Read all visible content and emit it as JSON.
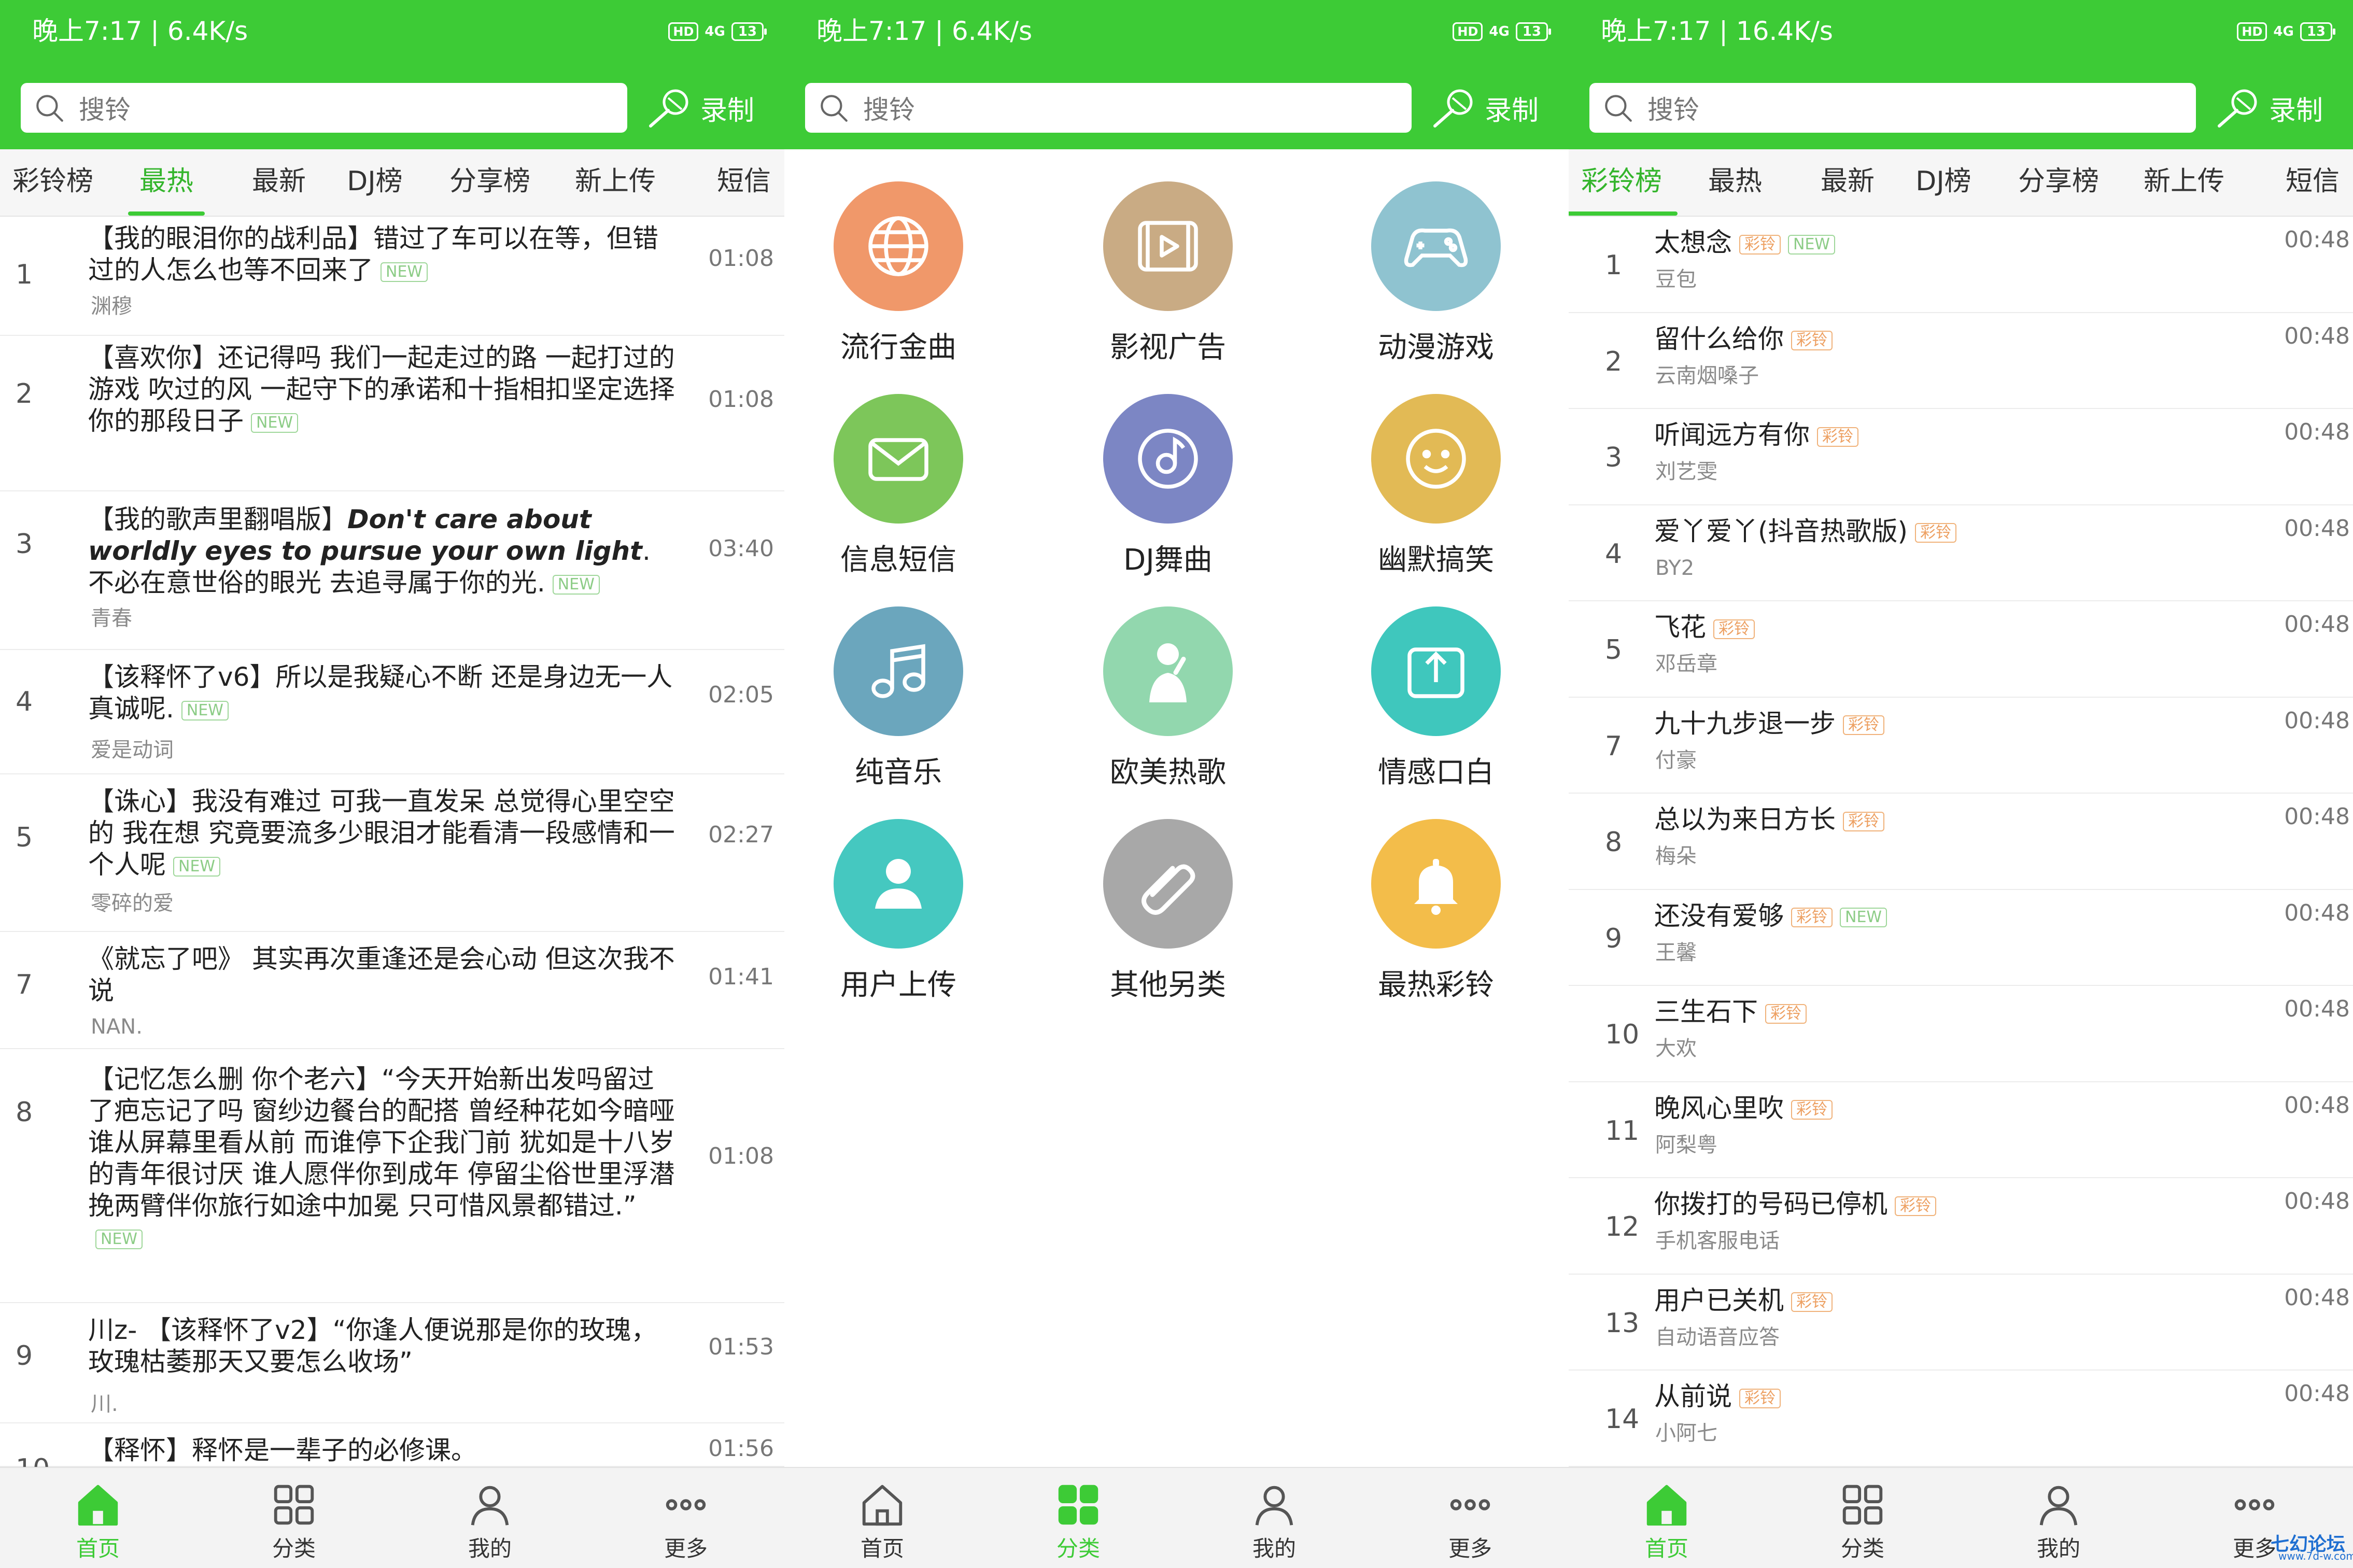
{
  "colors": {
    "accent": "#3dcb36",
    "badge_new": "#8ccc86",
    "badge_ring": "#eda062"
  },
  "screens": [
    {
      "status": {
        "time": "晚上7:17 | 6.4K/s",
        "hd": "HD",
        "signal": "4G",
        "battery": "13"
      },
      "search_placeholder": "搜铃",
      "record_label": "录制",
      "tabs": [
        "彩铃榜",
        "最热",
        "最新",
        "DJ榜",
        "分享榜",
        "新上传",
        "短信"
      ],
      "active_tab": "最热",
      "songs": [
        {
          "num": "1",
          "title": "【我的眼泪你的战利品】错过了车可以在等，但错过的人怎么也等不回来了",
          "badge": "NEW",
          "artist": "渊穆",
          "duration": "01:08"
        },
        {
          "num": "2",
          "title": "【喜欢你】还记得吗 我们一起走过的路 一起打过的游戏 吹过的风 一起守下的承诺和十指相扣坚定选择你的那段日子",
          "badge": "NEW",
          "artist": "",
          "duration": "01:08"
        },
        {
          "num": "3",
          "title_a": "【我的歌声里翻唱版】",
          "title_en": "Don't care about worldly eyes to pursue your own light",
          "title_b": ". 不必在意世俗的眼光 去追寻属于你的光.",
          "badge": "NEW",
          "artist": "青春",
          "duration": "03:40"
        },
        {
          "num": "4",
          "title": "【该释怀了v6】所以是我疑心不断 还是身边无一人真诚呢.",
          "badge": "NEW",
          "artist": "爱是动词",
          "duration": "02:05"
        },
        {
          "num": "5",
          "title": "【诛心】我没有难过 可我一直发呆 总觉得心里空空的 我在想 究竟要流多少眼泪才能看清一段感情和一个人呢",
          "badge": "NEW",
          "artist": "零碎的爱",
          "duration": "02:27"
        },
        {
          "num": "7",
          "title": "《就忘了吧》 其实再次重逢还是会心动 但这次我不说",
          "badge": "",
          "artist": "NAN.",
          "duration": "01:41"
        },
        {
          "num": "8",
          "title": "【记忆怎么删 你个老六】“今天开始新出发吗留过了疤忘记了吗 窗纱边餐台的配搭 曾经种花如今暗哑 谁从屏幕里看从前 而谁停下企我门前 犹如是十八岁的青年很讨厌 谁人愿伴你到成年 停留尘俗世里浮潜 挽两臂伴你旅行如途中加冕 只可惜风景都错过.”",
          "badge": "NEW",
          "artist": "",
          "duration": "01:08"
        },
        {
          "num": "9",
          "title": "川z- 【该释怀了v2】“你逢人便说那是你的玫瑰，玫瑰枯萎那天又要怎么收场”",
          "badge": "",
          "artist": "川.",
          "duration": "01:53"
        },
        {
          "num": "10",
          "title": "【释怀】释怀是一辈子的必修课。",
          "badge": "",
          "artist": "",
          "duration": "01:56"
        }
      ],
      "nav": [
        "首页",
        "分类",
        "我的",
        "更多"
      ],
      "active_nav": "首页"
    },
    {
      "status": {
        "time": "晚上7:17 | 6.4K/s",
        "hd": "HD",
        "signal": "4G",
        "battery": "13"
      },
      "search_placeholder": "搜铃",
      "record_label": "录制",
      "categories": [
        {
          "label": "流行金曲",
          "icon": "globe-icon",
          "color": "#f0986a"
        },
        {
          "label": "影视广告",
          "icon": "video-icon",
          "color": "#c9ab84"
        },
        {
          "label": "动漫游戏",
          "icon": "gamepad-icon",
          "color": "#8fc3d0"
        },
        {
          "label": "信息短信",
          "icon": "envelope-icon",
          "color": "#7dc65a"
        },
        {
          "label": "DJ舞曲",
          "icon": "disc-icon",
          "color": "#7c86c4"
        },
        {
          "label": "幽默搞笑",
          "icon": "smile-icon",
          "color": "#e2ba55"
        },
        {
          "label": "纯音乐",
          "icon": "music-note-icon",
          "color": "#6ba6bd"
        },
        {
          "label": "欧美热歌",
          "icon": "singer-icon",
          "color": "#92d7ae"
        },
        {
          "label": "情感口白",
          "icon": "share-icon",
          "color": "#3fc7bd"
        },
        {
          "label": "用户上传",
          "icon": "user-icon",
          "color": "#45c8c0"
        },
        {
          "label": "其他另类",
          "icon": "paperclip-icon",
          "color": "#a8a8a8"
        },
        {
          "label": "最热彩铃",
          "icon": "bell-icon",
          "color": "#f3bd4a"
        }
      ],
      "nav": [
        "首页",
        "分类",
        "我的",
        "更多"
      ],
      "active_nav": "分类"
    },
    {
      "status": {
        "time": "晚上7:17 | 16.4K/s",
        "hd": "HD",
        "signal": "4G",
        "battery": "13"
      },
      "search_placeholder": "搜铃",
      "record_label": "录制",
      "tabs": [
        "彩铃榜",
        "最热",
        "最新",
        "DJ榜",
        "分享榜",
        "新上传",
        "短信"
      ],
      "active_tab": "彩铃榜",
      "songs": [
        {
          "num": "1",
          "title": "太想念",
          "badges": [
            "彩铃",
            "NEW"
          ],
          "artist": "豆包",
          "duration": "00:48"
        },
        {
          "num": "2",
          "title": "留什么给你",
          "badges": [
            "彩铃"
          ],
          "artist": "云南烟嗓子",
          "duration": "00:48"
        },
        {
          "num": "3",
          "title": "听闻远方有你",
          "badges": [
            "彩铃"
          ],
          "artist": "刘艺雯",
          "duration": "00:48"
        },
        {
          "num": "4",
          "title": "爱丫爱丫(抖音热歌版)",
          "badges": [
            "彩铃"
          ],
          "artist": "BY2",
          "duration": "00:48"
        },
        {
          "num": "5",
          "title": "飞花",
          "badges": [
            "彩铃"
          ],
          "artist": "邓岳章",
          "duration": "00:48"
        },
        {
          "num": "7",
          "title": "九十九步退一步",
          "badges": [
            "彩铃"
          ],
          "artist": "付豪",
          "duration": "00:48"
        },
        {
          "num": "8",
          "title": "总以为来日方长",
          "badges": [
            "彩铃"
          ],
          "artist": "梅朵",
          "duration": "00:48"
        },
        {
          "num": "9",
          "title": "还没有爱够",
          "badges": [
            "彩铃",
            "NEW"
          ],
          "artist": "王馨",
          "duration": "00:48"
        },
        {
          "num": "10",
          "title": "三生石下",
          "badges": [
            "彩铃"
          ],
          "artist": "大欢",
          "duration": "00:48"
        },
        {
          "num": "11",
          "title": "晚风心里吹",
          "badges": [
            "彩铃"
          ],
          "artist": "阿梨粤",
          "duration": "00:48"
        },
        {
          "num": "12",
          "title": "你拨打的号码已停机",
          "badges": [
            "彩铃"
          ],
          "artist": "手机客服电话",
          "duration": "00:48"
        },
        {
          "num": "13",
          "title": "用户已关机",
          "badges": [
            "彩铃"
          ],
          "artist": "自动语音应答",
          "duration": "00:48"
        },
        {
          "num": "14",
          "title": "从前说",
          "badges": [
            "彩铃"
          ],
          "artist": "小阿七",
          "duration": "00:48"
        }
      ],
      "nav": [
        "首页",
        "分类",
        "我的",
        "更多"
      ],
      "active_nav": "首页"
    }
  ],
  "watermark": {
    "text": "七幻论坛",
    "sub": "www.7d-w.com"
  }
}
